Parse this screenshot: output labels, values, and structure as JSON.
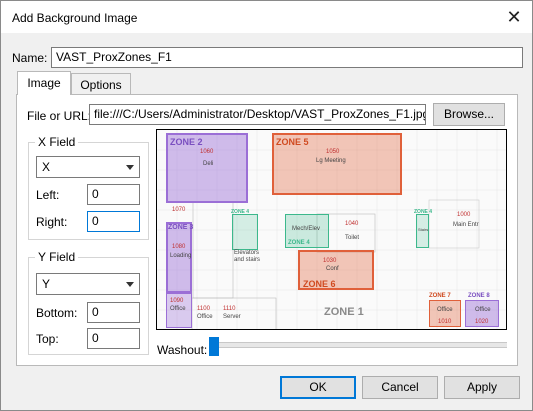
{
  "window": {
    "title": "Add Background Image",
    "close_glyph": "✕"
  },
  "name_field": {
    "label": "Name:",
    "value": "VAST_ProxZones_F1"
  },
  "tabs": [
    {
      "label": "Image",
      "active": true
    },
    {
      "label": "Options",
      "active": false
    }
  ],
  "file": {
    "label": "File or URL:",
    "value": "file:///C:/Users/Administrator/Desktop/VAST_ProxZones_F1.jpg",
    "browse_label": "Browse..."
  },
  "x_field": {
    "group_label": "X Field",
    "selected": "X",
    "left_label": "Left:",
    "left_value": "0",
    "right_label": "Right:",
    "right_value": "0"
  },
  "y_field": {
    "group_label": "Y Field",
    "selected": "Y",
    "bottom_label": "Bottom:",
    "bottom_value": "0",
    "top_label": "Top:",
    "top_value": "0"
  },
  "washout": {
    "label": "Washout:",
    "level": 0
  },
  "buttons": {
    "ok": "OK",
    "cancel": "Cancel",
    "apply": "Apply"
  },
  "colors": {
    "accent": "#0078d7",
    "zone_purple": "#9b6fd6",
    "zone_orange": "#e0603a",
    "zone_green": "#3cb88c"
  },
  "preview": {
    "zones": {
      "z2": "ZONE 2",
      "z3": "ZONE 3",
      "z4a": "ZONE 4",
      "z4b": "ZONE 4",
      "z4c": "ZONE 4",
      "z5": "ZONE 5",
      "z6": "ZONE 6",
      "z1": "ZONE 1",
      "z7": "ZONE 7",
      "z8": "ZONE 8"
    },
    "rooms": {
      "r1060": "1060",
      "deli": "Deli",
      "r1050": "1050",
      "lgmeeting": "Lg Meeting",
      "r1070": "1070",
      "r1080": "1080",
      "loading": "Loading",
      "elev": "Elevators",
      "elev2": "and stairs",
      "mech": "Mech/Elev",
      "r1040": "1040",
      "toilet": "Toilet",
      "r1030": "1030",
      "conf": "Conf",
      "stairs": "Stairs",
      "r1000": "1000",
      "mainentr": "Main Entr",
      "r1090": "1090",
      "office1": "Office",
      "r1100": "1100",
      "office2": "Office",
      "r1110": "1110",
      "server": "Server",
      "office3": "Office",
      "r1010": "1010",
      "office4": "Office",
      "r1020": "1020"
    }
  }
}
